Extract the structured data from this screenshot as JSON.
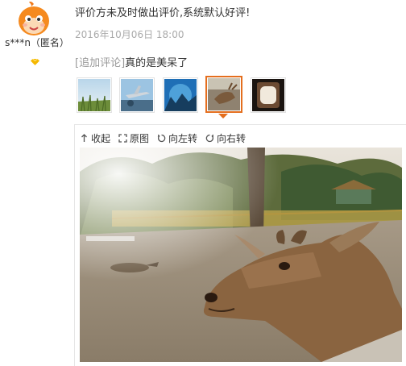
{
  "user": {
    "name": "s***n（匿名）",
    "avatar_icon": "orange-mascot-avatar-icon",
    "level_icon": "diamond-level-icon"
  },
  "review": {
    "text": "评价方未及时做出评价,系统默认好评!",
    "date": "2016年10月06日 18:00",
    "followup_tag": "[追加评论]",
    "followup_text": "真的是美呆了"
  },
  "thumbnails": [
    {
      "name": "thumb-grass-sky"
    },
    {
      "name": "thumb-airplane"
    },
    {
      "name": "thumb-blue-sky-tree"
    },
    {
      "name": "thumb-deer",
      "active": true
    },
    {
      "name": "thumb-window"
    }
  ],
  "toolbar": {
    "collapse_label": "收起",
    "original_label": "原图",
    "rotate_left_label": "向左转",
    "rotate_right_label": "向右转"
  },
  "colors": {
    "accent": "#e46e1e",
    "muted_text": "#999999",
    "date_text": "#aaaaaa"
  }
}
